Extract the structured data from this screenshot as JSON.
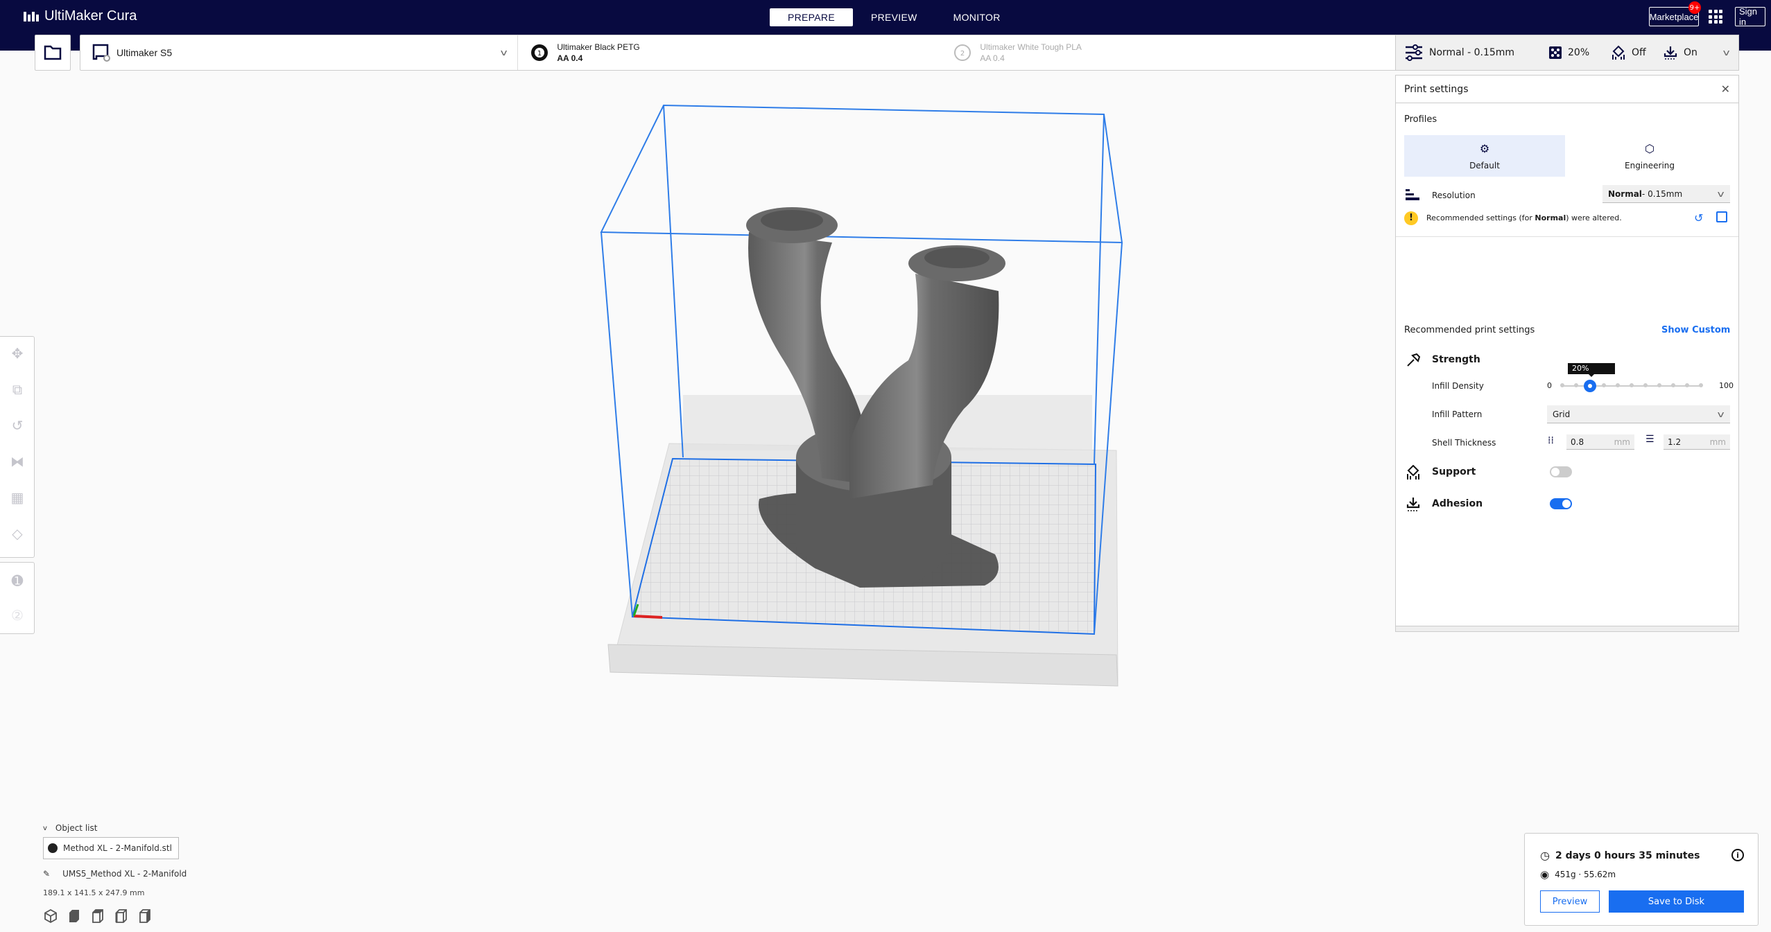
{
  "app": {
    "title": "UltiMaker Cura"
  },
  "nav": {
    "tabs": [
      {
        "label": "PREPARE",
        "active": true
      },
      {
        "label": "PREVIEW",
        "active": false
      },
      {
        "label": "MONITOR",
        "active": false
      }
    ]
  },
  "header": {
    "marketplace_label": "Marketplace",
    "marketplace_badge": "9+",
    "signin_label": "Sign in"
  },
  "machine": {
    "name": "Ultimaker S5"
  },
  "extruders": [
    {
      "index": "1",
      "material": "Ultimaker Black PETG",
      "core": "AA 0.4",
      "enabled": true
    },
    {
      "index": "2",
      "material": "Ultimaker White Tough PLA",
      "core": "AA 0.4",
      "enabled": false
    }
  ],
  "summary_bar": {
    "profile": "Normal - 0.15mm",
    "infill": "20%",
    "support": "Off",
    "adhesion": "On"
  },
  "print_settings": {
    "title": "Print settings",
    "profiles_label": "Profiles",
    "profiles": [
      {
        "label": "Default",
        "active": true
      },
      {
        "label": "Engineering",
        "active": false
      }
    ],
    "resolution_label": "Resolution",
    "resolution_bold": "Normal",
    "resolution_rest": " - 0.15mm",
    "warning_pre": "Recommended settings (for ",
    "warning_bold": "Normal",
    "warning_post": ") were altered.",
    "recommended_label": "Recommended print settings",
    "show_custom_label": "Show Custom",
    "strength_label": "Strength",
    "infill_density_label": "Infill Density",
    "infill_min": "0",
    "infill_max": "100",
    "infill_value": 20,
    "infill_tooltip": "20%",
    "infill_pattern_label": "Infill Pattern",
    "infill_pattern_value": "Grid",
    "shell_thickness_label": "Shell Thickness",
    "wall_thickness": "0.8",
    "top_bottom_thickness": "1.2",
    "unit": "mm",
    "support_label": "Support",
    "support_on": false,
    "adhesion_label": "Adhesion",
    "adhesion_on": true
  },
  "object_list": {
    "header": "Object list",
    "items": [
      {
        "name": "Method XL - 2-Manifold.stl"
      }
    ],
    "job_name": "UMS5_Method XL - 2-Manifold",
    "dimensions": "189.1 x 141.5 x 247.9 mm"
  },
  "print_summary": {
    "time": "2 days 0 hours 35 minutes",
    "material": "451g · 55.62m",
    "preview_label": "Preview",
    "save_label": "Save to Disk"
  },
  "colors": {
    "brand_navy": "#080a40",
    "accent_blue": "#196ef0",
    "warning_yellow": "#ffc924",
    "model_gray": "#6b6b6b"
  }
}
